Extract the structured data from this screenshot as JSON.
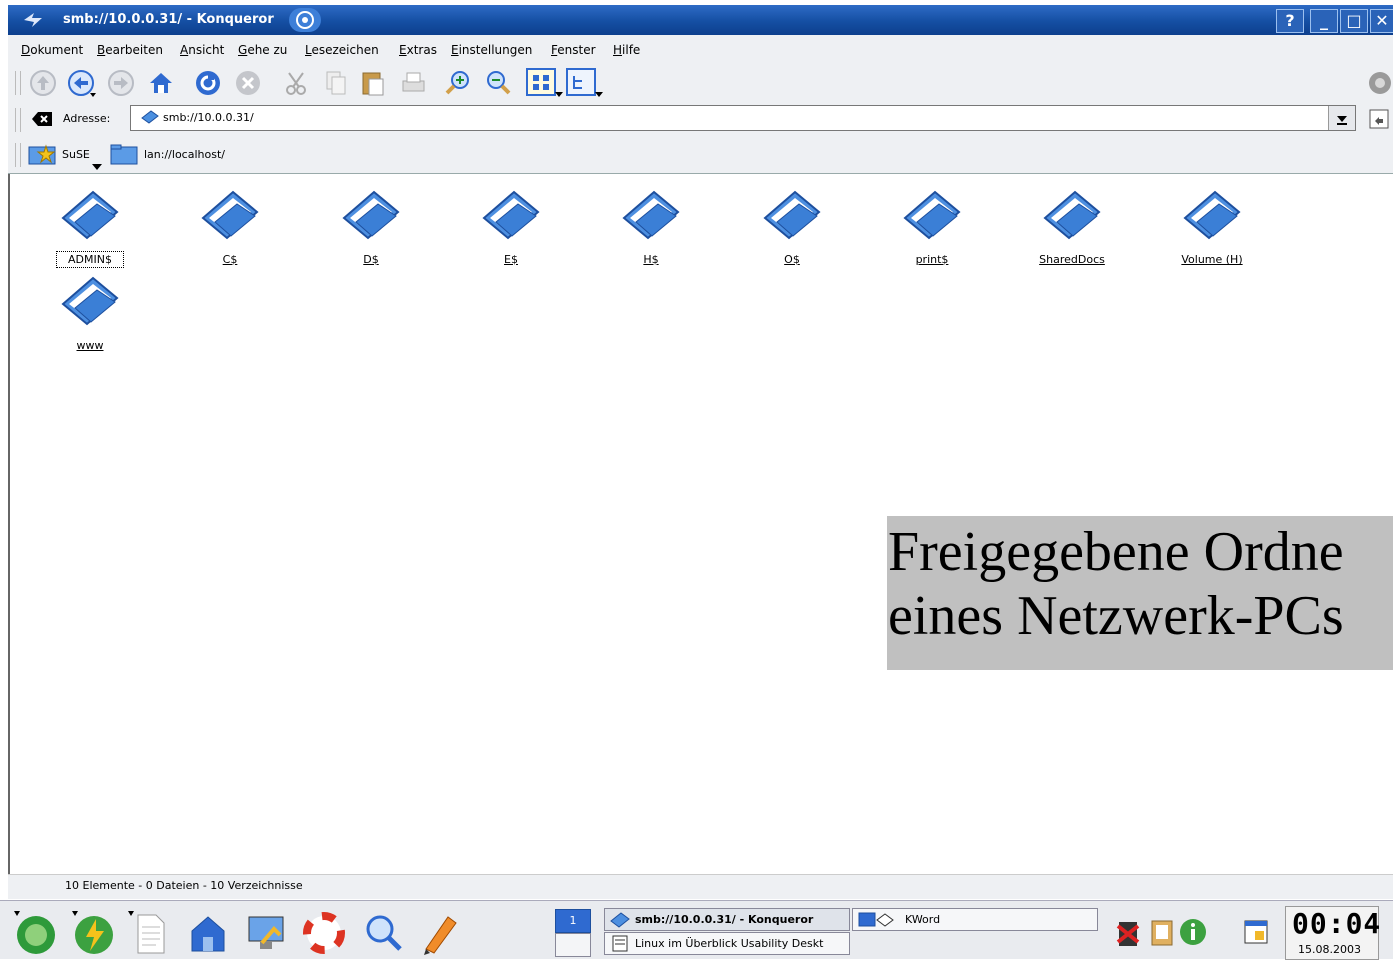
{
  "window": {
    "title": "smb://10.0.0.31/ - Konqueror",
    "buttons": [
      "?",
      "_",
      "□",
      "✕"
    ]
  },
  "menu": [
    "Dokument",
    "Bearbeiten",
    "Ansicht",
    "Gehe zu",
    "Lesezeichen",
    "Extras",
    "Einstellungen",
    "Fenster",
    "Hilfe"
  ],
  "address": {
    "label": "Adresse:",
    "value": "smb://10.0.0.31/"
  },
  "bookmarks": [
    {
      "label": "SuSE"
    },
    {
      "label": "lan://localhost/"
    }
  ],
  "folders": [
    "ADMIN$",
    "C$",
    "D$",
    "E$",
    "H$",
    "O$",
    "print$",
    "SharedDocs",
    "Volume (H)",
    "www"
  ],
  "status": "10 Elemente - 0 Dateien - 10 Verzeichnisse",
  "overlay": {
    "line1": "Freigegebene Ordne",
    "line2": "eines Netzwerk-PCs"
  },
  "taskbar": {
    "desktop_number": "1",
    "tasks": [
      "smb://10.0.0.31/ - Konqueror",
      "Linux im Überblick Usability Deskt",
      "KWord"
    ],
    "clock_time": "00:04",
    "clock_date": "15.08.2003"
  },
  "colors": {
    "title_blue": "#154fa3",
    "chrome_gray": "#eef0f3",
    "overlay_gray": "#c0c0c0"
  }
}
